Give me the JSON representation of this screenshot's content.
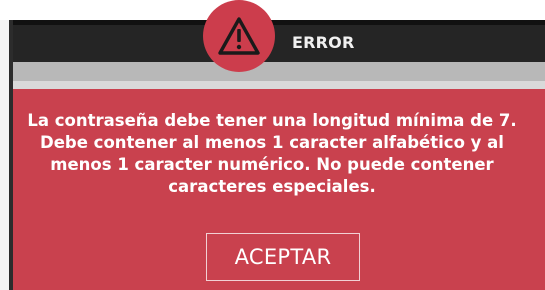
{
  "dialog": {
    "title": "ERROR",
    "message": "La contraseña debe tener una longitud mínima de 7.\nDebe contener al menos 1 caracter alfabético y al\nmenos 1 caracter numérico. No puede contener\ncaracteres especiales.",
    "accept_label": "ACEPTAR",
    "icon": "warning-icon"
  },
  "colors": {
    "panel": "#c9414e",
    "icon_circle": "#cc3d4c",
    "header": "#252525",
    "text": "#ffffff"
  }
}
